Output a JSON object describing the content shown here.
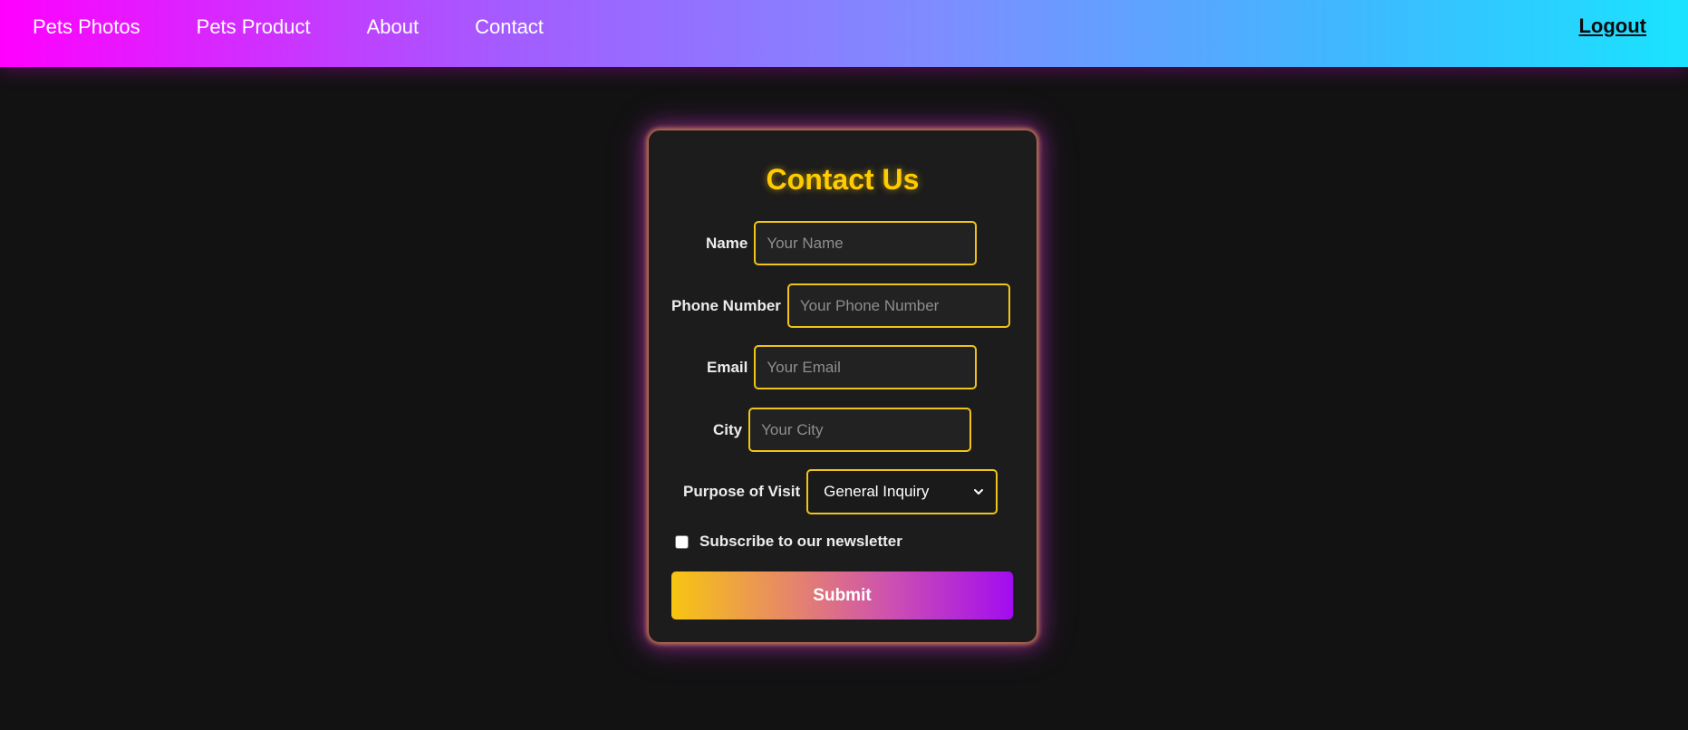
{
  "nav": {
    "links": [
      {
        "label": "Pets Photos"
      },
      {
        "label": "Pets Product"
      },
      {
        "label": "About"
      },
      {
        "label": "Contact"
      }
    ],
    "logout_label": "Logout"
  },
  "form": {
    "title": "Contact Us",
    "fields": {
      "name": {
        "label": "Name",
        "placeholder": "Your Name"
      },
      "phone": {
        "label": "Phone Number",
        "placeholder": "Your Phone Number"
      },
      "email": {
        "label": "Email",
        "placeholder": "Your Email"
      },
      "city": {
        "label": "City",
        "placeholder": "Your City"
      }
    },
    "purpose": {
      "label": "Purpose of Visit",
      "selected": "General Inquiry"
    },
    "newsletter": {
      "label": "Subscribe to our newsletter",
      "checked": false
    },
    "submit_label": "Submit"
  },
  "colors": {
    "accent": "#f0c419",
    "title": "#ffcc00",
    "background": "#121212",
    "card": "#1c1c1c"
  },
  "icons": {
    "select_arrow": "chevron-down-icon"
  }
}
